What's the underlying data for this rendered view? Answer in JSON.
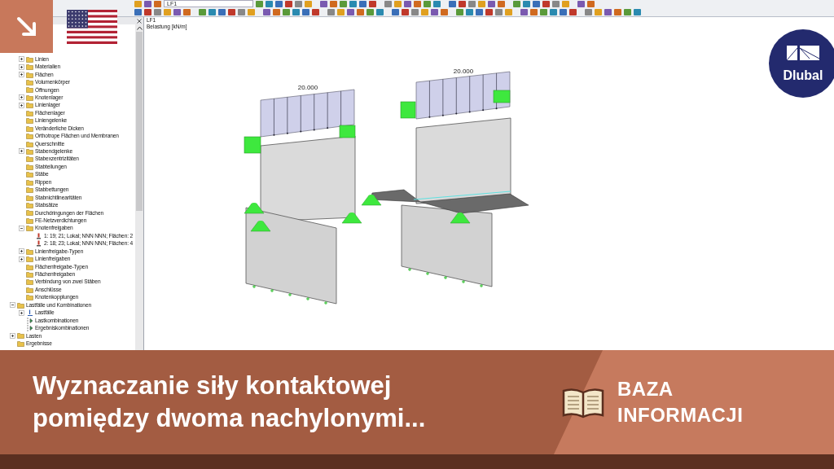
{
  "toolbar": {
    "load_case": "LF1"
  },
  "navigator": {
    "items": [
      {
        "label": "Linien",
        "kind": "folder",
        "expanded": false
      },
      {
        "label": "Materialien",
        "kind": "folder",
        "expanded": false
      },
      {
        "label": "Flächen",
        "kind": "folder",
        "expanded": false
      },
      {
        "label": "Volumenkörper",
        "kind": "folder"
      },
      {
        "label": "Öffnungen",
        "kind": "folder"
      },
      {
        "label": "Knotenlager",
        "kind": "folder",
        "expanded": false
      },
      {
        "label": "Linienlager",
        "kind": "folder",
        "expanded": false
      },
      {
        "label": "Flächenlager",
        "kind": "folder"
      },
      {
        "label": "Liniengelenke",
        "kind": "folder"
      },
      {
        "label": "Veränderliche Dicken",
        "kind": "folder"
      },
      {
        "label": "Orthotrope Flächen und Membranen",
        "kind": "folder"
      },
      {
        "label": "Querschnitte",
        "kind": "folder"
      },
      {
        "label": "Stabendgelenke",
        "kind": "folder",
        "expanded": false
      },
      {
        "label": "Stabexzentrizitäten",
        "kind": "folder"
      },
      {
        "label": "Stabteilungen",
        "kind": "folder"
      },
      {
        "label": "Stäbe",
        "kind": "folder"
      },
      {
        "label": "Rippen",
        "kind": "folder"
      },
      {
        "label": "Stabbettungen",
        "kind": "folder"
      },
      {
        "label": "Stabnichtlinearitäten",
        "kind": "folder"
      },
      {
        "label": "Stabsätze",
        "kind": "folder"
      },
      {
        "label": "Durchdringungen der Flächen",
        "kind": "folder"
      },
      {
        "label": "FE-Netzverdichtungen",
        "kind": "folder"
      },
      {
        "label": "Knotenfreigaben",
        "kind": "folder",
        "expanded": true,
        "children": [
          {
            "label": "1: 19; 21; Lokal; NNN NNN; Flächen: 2",
            "kind": "release"
          },
          {
            "label": "2: 18; 23; Lokal; NNN NNN; Flächen: 4",
            "kind": "release"
          }
        ]
      },
      {
        "label": "Linienfreigabe-Typen",
        "kind": "folder",
        "expanded": false
      },
      {
        "label": "Linienfreigaben",
        "kind": "folder",
        "expanded": false
      },
      {
        "label": "Flächenfreigabe-Typen",
        "kind": "folder"
      },
      {
        "label": "Flächenfreigaben",
        "kind": "folder"
      },
      {
        "label": "Verbindung von zwei Stäben",
        "kind": "folder"
      },
      {
        "label": "Anschlüsse",
        "kind": "folder"
      },
      {
        "label": "Knotenkopplungen",
        "kind": "folder"
      }
    ],
    "root_items": [
      {
        "label": "Lastfälle und Kombinationen",
        "kind": "folder",
        "expanded": true,
        "children": [
          {
            "label": "Lastfälle",
            "kind": "load-case",
            "expanded": false
          },
          {
            "label": "Lastkombinationen",
            "kind": "combination"
          },
          {
            "label": "Ergebniskombinationen",
            "kind": "combination"
          }
        ]
      },
      {
        "label": "Lasten",
        "kind": "folder",
        "expanded": false
      },
      {
        "label": "Ergebnisse",
        "kind": "folder"
      }
    ]
  },
  "view": {
    "title": "LF1",
    "subtitle": "Belastung [kN/m]",
    "load_labels": [
      "20.000",
      "20.000"
    ]
  },
  "logo": {
    "text": "Dlubal"
  },
  "banner": {
    "title": "Wyznaczanie siły kontaktowej pomiędzy dwoma nachylonymi...",
    "category": "BAZA INFORMACJI"
  }
}
